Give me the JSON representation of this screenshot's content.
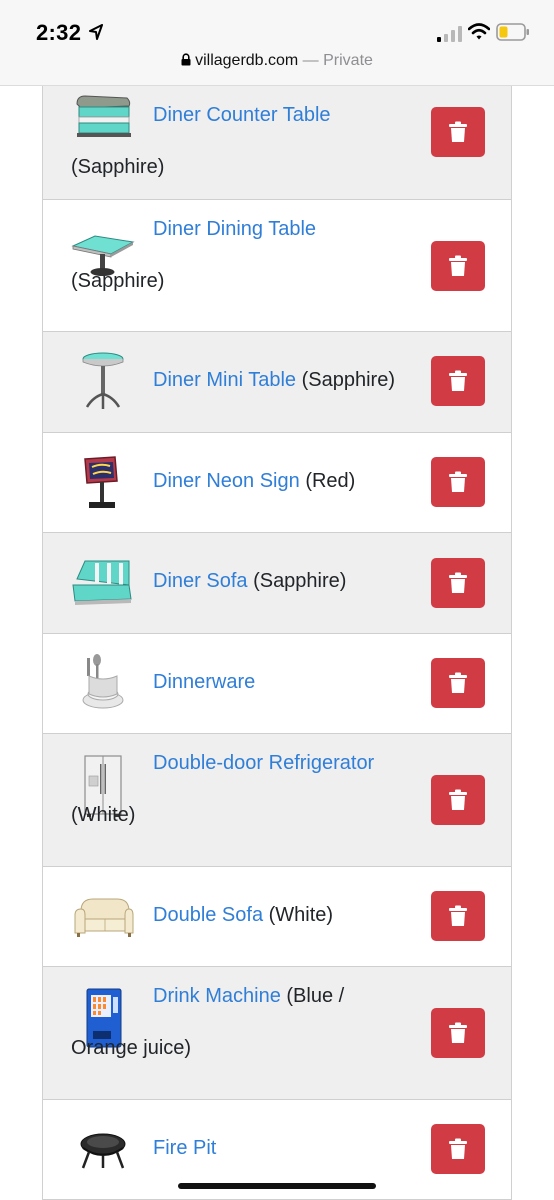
{
  "status_bar": {
    "time": "2:32",
    "url_host": "villagerdb.com",
    "url_suffix": " — Private"
  },
  "items": [
    {
      "name": "Diner Counter Table",
      "variant": "(Sapphire)",
      "icon": "diner-counter-table-icon"
    },
    {
      "name": "Diner Dining Table",
      "variant": "(Sapphire)",
      "icon": "diner-dining-table-icon"
    },
    {
      "name": "Diner Mini Table",
      "variant": "(Sapphire)",
      "icon": "diner-mini-table-icon"
    },
    {
      "name": "Diner Neon Sign",
      "variant": "(Red)",
      "icon": "diner-neon-sign-icon"
    },
    {
      "name": "Diner Sofa",
      "variant": "(Sapphire)",
      "icon": "diner-sofa-icon"
    },
    {
      "name": "Dinnerware",
      "variant": "",
      "icon": "dinnerware-icon"
    },
    {
      "name": "Double-door Refrigerator",
      "variant": "(White)",
      "icon": "refrigerator-icon"
    },
    {
      "name": "Double Sofa",
      "variant": "(White)",
      "icon": "double-sofa-icon"
    },
    {
      "name": "Drink Machine",
      "variant": "(Blue / Orange juice)",
      "icon": "drink-machine-icon"
    },
    {
      "name": "Fire Pit",
      "variant": "",
      "icon": "fire-pit-icon"
    }
  ],
  "colors": {
    "link": "#2f7ed8",
    "delete_button": "#d13b44",
    "row_alt": "#efefef"
  }
}
